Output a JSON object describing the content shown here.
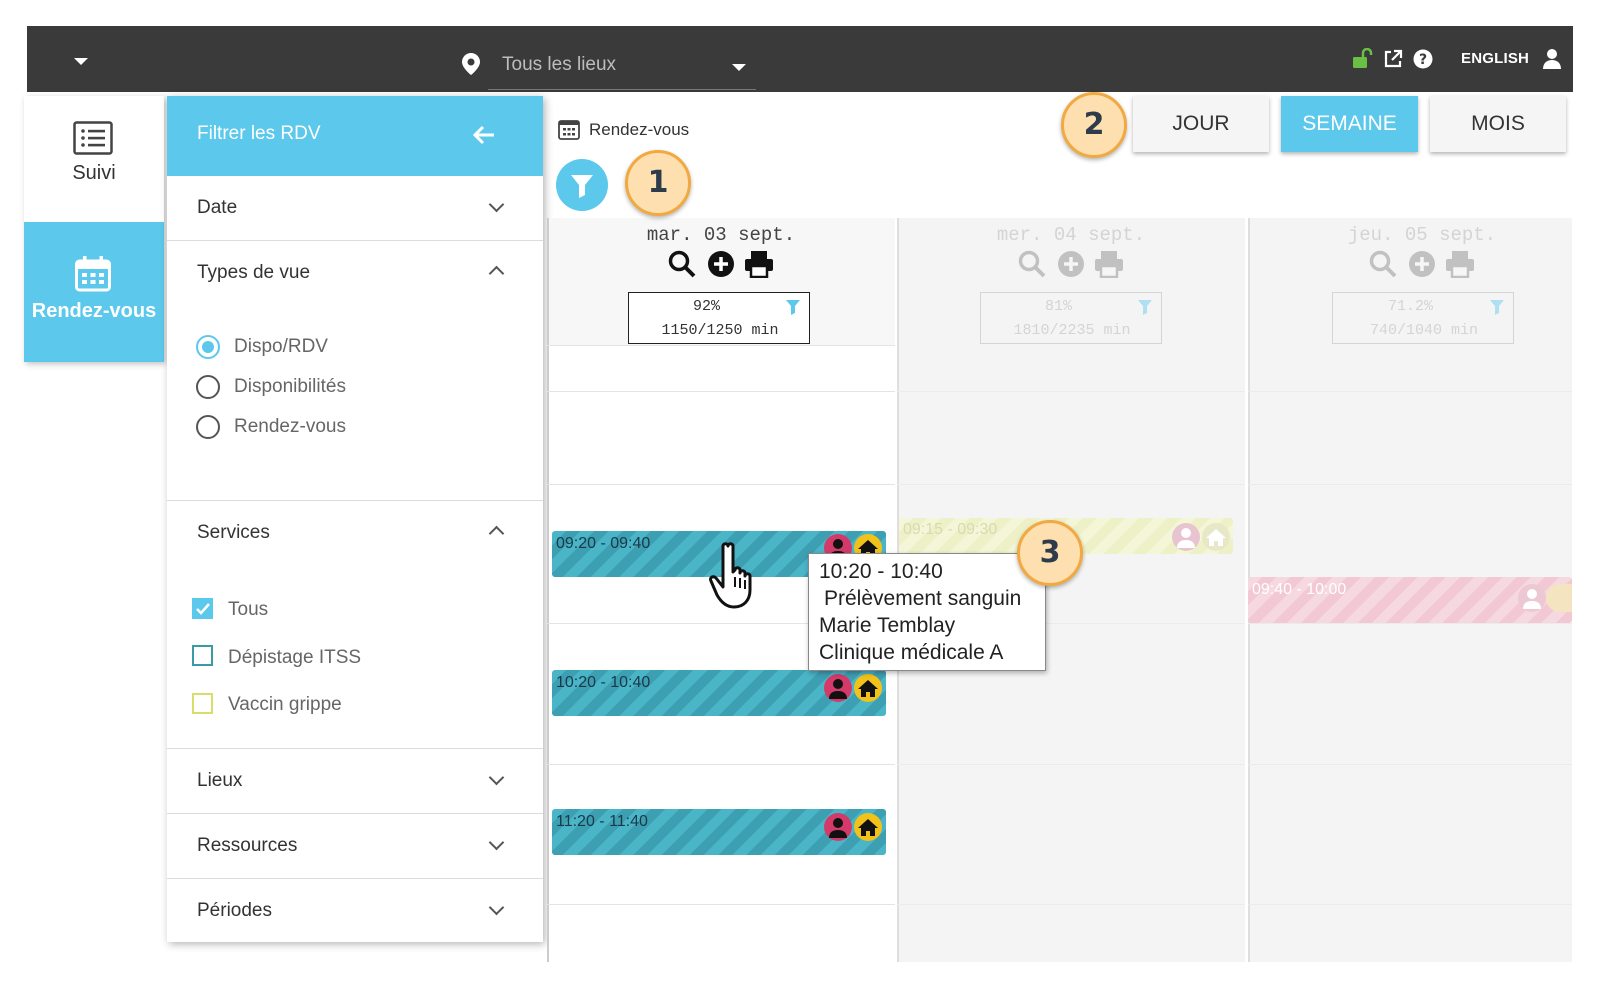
{
  "topbar": {
    "location_label": "Tous les lieux",
    "language": "ENGLISH",
    "icons": [
      "unlock-icon",
      "external-link-icon",
      "help-icon",
      "user-icon",
      "location-pin-icon"
    ]
  },
  "nav": {
    "items": [
      {
        "label": "Suivi",
        "icon": "list-icon"
      },
      {
        "label": "Rendez-vous",
        "icon": "calendar-icon",
        "active": true
      }
    ]
  },
  "filter_panel": {
    "title": "Filtrer les RDV",
    "sections": {
      "date": "Date",
      "view_types": "Types de vue",
      "services": "Services",
      "places": "Lieux",
      "resources": "Ressources",
      "periods": "Périodes"
    },
    "view_options": [
      {
        "label": "Dispo/RDV",
        "selected": true
      },
      {
        "label": "Disponibilités",
        "selected": false
      },
      {
        "label": "Rendez-vous",
        "selected": false
      }
    ],
    "services": [
      {
        "label": "Tous",
        "checked": true,
        "color": "#5bc8ec"
      },
      {
        "label": "Dépistage ITSS",
        "checked": false,
        "color": "#3a9aa5"
      },
      {
        "label": "Vaccin grippe",
        "checked": false,
        "color": "#d9dd6a"
      }
    ]
  },
  "calendar": {
    "title": "Rendez-vous",
    "views": {
      "day": "JOUR",
      "week": "SEMAINE",
      "month": "MOIS",
      "active": "week"
    },
    "days": [
      {
        "label": "mar. 03 sept.",
        "percent": "92%",
        "minutes": "1150/1250 min",
        "faded": false
      },
      {
        "label": "mer. 04 sept.",
        "percent": "81%",
        "minutes": "1810/2235 min",
        "faded": true
      },
      {
        "label": "jeu. 05 sept.",
        "percent": "71.2%",
        "minutes": "740/1040 min",
        "faded": true
      }
    ],
    "events": {
      "day1": [
        "09:20 - 09:40",
        "10:20 - 10:40",
        "11:20 - 11:40"
      ],
      "day2": [
        "09:15 - 09:30"
      ],
      "day3": [
        "09:40 - 10:00"
      ]
    },
    "tooltip": {
      "time": "10:20 - 10:40",
      "service": "Prélèvement sanguin",
      "patient": "Marie Temblay",
      "place": "Clinique médicale A"
    }
  },
  "badges": {
    "one": "1",
    "two": "2",
    "three": "3"
  },
  "colors": {
    "accent": "#5bc8ec",
    "topbar": "#3a3a3a",
    "badge_fill": "#fddfb0",
    "badge_border": "#f1a940",
    "event_teal": "#4bb5c8",
    "avatar_pink": "#d33a6a",
    "home_yellow": "#f2c11a"
  }
}
